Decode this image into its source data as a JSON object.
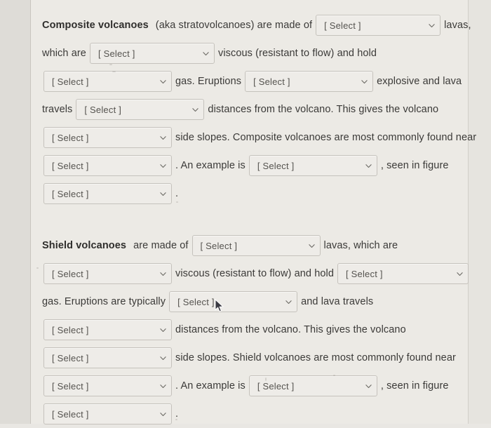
{
  "common": {
    "select_placeholder": "[ Select ]",
    "chevron_icon": "chevron-down-icon",
    "cursor_icon": "mouse-pointer-icon"
  },
  "colors": {
    "page_background": "#e9e7e3",
    "content_background": "#eceae5",
    "gutter_background": "#dedcd7",
    "rule": "#c8c5bf",
    "text": "#3b3a38",
    "heading_text": "#2f2e2c",
    "select_background": "#eeece8",
    "select_border": "#c5c2bc",
    "placeholder_text": "#55534f"
  },
  "composite": {
    "lines": [
      {
        "id": "composite-line-1",
        "segments": [
          {
            "type": "text",
            "value": "Composite volcanoes",
            "bold": true
          },
          {
            "type": "text",
            "value": "(aka stratovolcanoes) are made of",
            "bold": false
          },
          {
            "type": "select",
            "name": "composite-lava-composition-select"
          },
          {
            "type": "text",
            "value": "lavas,",
            "bold": false
          }
        ]
      },
      {
        "id": "composite-line-2",
        "segments": [
          {
            "type": "text",
            "value": "which are",
            "bold": false
          },
          {
            "type": "select",
            "name": "composite-viscosity-select"
          },
          {
            "type": "text",
            "value": "viscous (resistant to flow) and hold",
            "bold": false
          }
        ]
      },
      {
        "id": "composite-line-3",
        "segments": [
          {
            "type": "select",
            "name": "composite-gas-amount-select"
          },
          {
            "type": "text",
            "value": "gas.  Eruptions",
            "bold": false
          },
          {
            "type": "select",
            "name": "composite-eruption-style-select"
          },
          {
            "type": "text",
            "value": "explosive and lava",
            "bold": false
          }
        ]
      },
      {
        "id": "composite-line-4",
        "segments": [
          {
            "type": "text",
            "value": "travels",
            "bold": false
          },
          {
            "type": "select",
            "name": "composite-lava-travel-distance-select"
          },
          {
            "type": "text",
            "value": "distances from the volcano. This gives the volcano",
            "bold": false
          }
        ]
      },
      {
        "id": "composite-line-5",
        "segments": [
          {
            "type": "select",
            "name": "composite-slope-steepness-select"
          },
          {
            "type": "text",
            "value": "side slopes.  Composite volcanoes are most commonly found near",
            "bold": false
          }
        ]
      },
      {
        "id": "composite-line-6",
        "segments": [
          {
            "type": "select",
            "name": "composite-tectonic-setting-select"
          },
          {
            "type": "text",
            "value": ". An example is",
            "bold": false
          },
          {
            "type": "select",
            "name": "composite-example-volcano-select"
          },
          {
            "type": "text",
            "value": ", seen in figure",
            "bold": false
          }
        ]
      },
      {
        "id": "composite-line-7",
        "segments": [
          {
            "type": "select",
            "name": "composite-figure-number-select"
          },
          {
            "type": "text",
            "value": ".",
            "bold": false
          }
        ]
      }
    ]
  },
  "shield": {
    "lines": [
      {
        "id": "shield-line-1",
        "segments": [
          {
            "type": "text",
            "value": "Shield volcanoes",
            "bold": true
          },
          {
            "type": "text",
            "value": "are made of",
            "bold": false
          },
          {
            "type": "select",
            "name": "shield-lava-composition-select"
          },
          {
            "type": "text",
            "value": "lavas, which are",
            "bold": false
          }
        ]
      },
      {
        "id": "shield-line-2",
        "segments": [
          {
            "type": "select",
            "name": "shield-viscosity-select"
          },
          {
            "type": "text",
            "value": "viscous (resistant to flow) and hold",
            "bold": false
          },
          {
            "type": "select",
            "name": "shield-gas-amount-select"
          }
        ]
      },
      {
        "id": "shield-line-3",
        "segments": [
          {
            "type": "text",
            "value": "gas.  Eruptions are typically",
            "bold": false
          },
          {
            "type": "select",
            "name": "shield-eruption-style-select"
          },
          {
            "type": "text",
            "value": "and lava travels",
            "bold": false
          }
        ]
      },
      {
        "id": "shield-line-4",
        "segments": [
          {
            "type": "select",
            "name": "shield-lava-travel-distance-select"
          },
          {
            "type": "text",
            "value": "distances from the volcano. This gives the volcano",
            "bold": false
          }
        ]
      },
      {
        "id": "shield-line-5",
        "segments": [
          {
            "type": "select",
            "name": "shield-slope-steepness-select"
          },
          {
            "type": "text",
            "value": "side slopes.  Shield volcanoes are most commonly found near",
            "bold": false
          }
        ]
      },
      {
        "id": "shield-line-6",
        "segments": [
          {
            "type": "select",
            "name": "shield-tectonic-setting-select"
          },
          {
            "type": "text",
            "value": ". An example is",
            "bold": false
          },
          {
            "type": "select",
            "name": "shield-example-volcano-select"
          },
          {
            "type": "text",
            "value": ", seen in figure",
            "bold": false
          }
        ]
      },
      {
        "id": "shield-line-7",
        "segments": [
          {
            "type": "select",
            "name": "shield-figure-number-select"
          },
          {
            "type": "text",
            "value": ".",
            "bold": false
          }
        ]
      }
    ]
  }
}
